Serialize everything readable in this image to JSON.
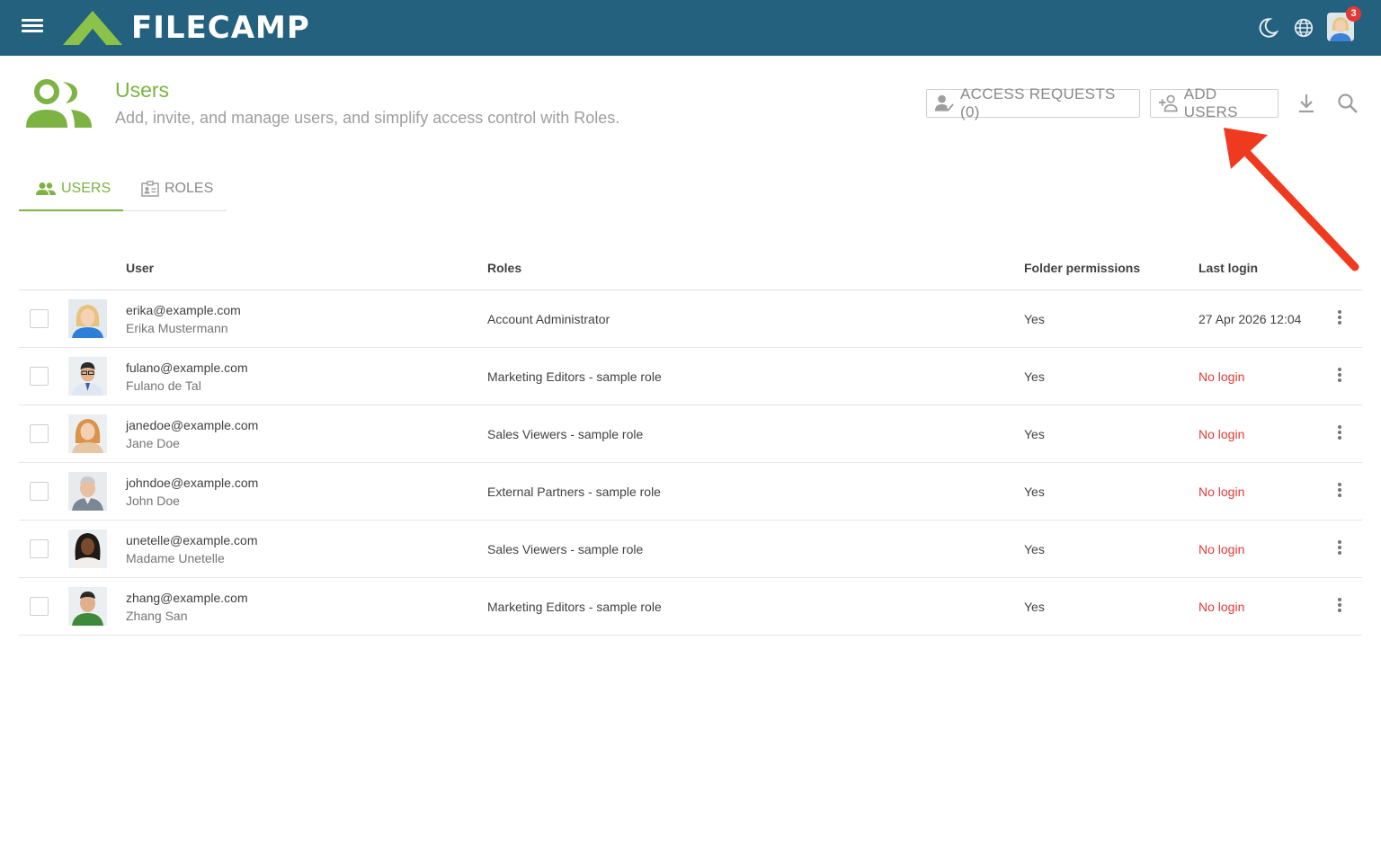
{
  "app": {
    "logo_text": "FILECAMP",
    "notification_count": "3"
  },
  "header": {
    "title": "Users",
    "subtitle": "Add, invite, and manage users, and simplify access control with Roles.",
    "access_requests_label": "ACCESS REQUESTS (0)",
    "add_users_label": "ADD USERS"
  },
  "tabs": [
    {
      "label": "USERS",
      "active": true
    },
    {
      "label": "ROLES",
      "active": false
    }
  ],
  "table": {
    "columns": [
      "User",
      "Roles",
      "Folder permissions",
      "Last login"
    ],
    "rows": [
      {
        "email": "erika@example.com",
        "name": "Erika Mustermann",
        "role": "Account Administrator",
        "folder_permissions": "Yes",
        "last_login": "27 Apr 2026 12:04",
        "avatar": "blonde-woman-avatar"
      },
      {
        "email": "fulano@example.com",
        "name": "Fulano de Tal",
        "role": "Marketing Editors - sample role",
        "folder_permissions": "Yes",
        "last_login": "No login",
        "avatar": "man-glasses-avatar"
      },
      {
        "email": "janedoe@example.com",
        "name": "Jane Doe",
        "role": "Sales Viewers - sample role",
        "folder_permissions": "Yes",
        "last_login": "No login",
        "avatar": "redhead-woman-avatar"
      },
      {
        "email": "johndoe@example.com",
        "name": "John Doe",
        "role": "External Partners - sample role",
        "folder_permissions": "Yes",
        "last_login": "No login",
        "avatar": "older-man-avatar"
      },
      {
        "email": "unetelle@example.com",
        "name": "Madame Unetelle",
        "role": "Sales Viewers - sample role",
        "folder_permissions": "Yes",
        "last_login": "No login",
        "avatar": "dark-hair-woman-avatar"
      },
      {
        "email": "zhang@example.com",
        "name": "Zhang San",
        "role": "Marketing Editors - sample role",
        "folder_permissions": "Yes",
        "last_login": "No login",
        "avatar": "man-green-shirt-avatar"
      }
    ]
  },
  "colors": {
    "topbar": "#23617e",
    "accent_green": "#7cb342",
    "no_login_red": "#e53935",
    "annotation_arrow": "#f03a1f"
  }
}
